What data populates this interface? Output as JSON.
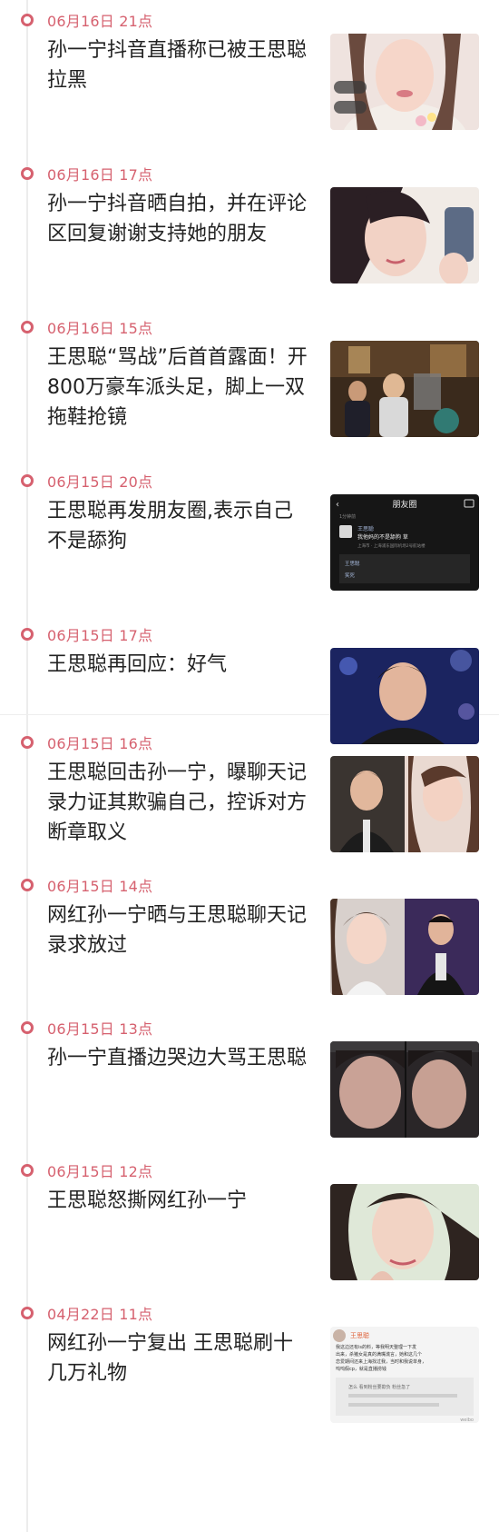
{
  "feed": {
    "items": [
      {
        "time": "06月16日 21点",
        "title": "孙一宁抖音直播称已被王思聪拉黑",
        "thumbnail": "livestream-screenshot"
      },
      {
        "time": "06月16日 17点",
        "title": "孙一宁抖音晒自拍，并在评论区回复谢谢支持她的朋友",
        "thumbnail": "selfie-photo"
      },
      {
        "time": "06月16日 15点",
        "title": "王思聪“骂战”后首首露面！开800万豪车派头足，脚上一双拖鞋抢镜",
        "thumbnail": "night-street-photo"
      },
      {
        "time": "06月15日 20点",
        "title": "王思聪再发朋友圈,表示自己不是舔狗",
        "thumbnail": "moments-screenshot",
        "moments": {
          "header": "朋友圈",
          "timestamp": "1分钟前",
          "name": "王思聪",
          "text": "我他妈的不是舔狗 草",
          "location": "上海市 · 上海浦东国际机场2号航站楼",
          "like": "王思聪",
          "reply": "笑死"
        }
      },
      {
        "time": "06月15日 17点",
        "title": "王思聪再回应：好气",
        "thumbnail": "portrait-photo"
      },
      {
        "time": "06月15日 16点",
        "title": "王思聪回击孙一宁，曝聊天记录力证其欺骗自己，控诉对方断章取义",
        "thumbnail": "split-portraits"
      },
      {
        "time": "06月15日 14点",
        "title": "网红孙一宁晒与王思聪聊天记录求放过",
        "thumbnail": "split-portraits-2"
      },
      {
        "time": "06月15日 13点",
        "title": "孙一宁直播边哭边大骂王思聪",
        "thumbnail": "livestream-crying"
      },
      {
        "time": "06月15日 12点",
        "title": "王思聪怒撕网红孙一宁",
        "thumbnail": "portrait-photo-2"
      },
      {
        "time": "04月22日 11点",
        "title": "网红孙一宁复出 王思聪刷十几万礼物",
        "thumbnail": "comment-screenshot",
        "comment": {
          "name": "王思聪",
          "lines": [
            "我这边还有is的料，等我明天整理一下发",
            "出来，杀猪女是真的满嘴谎言，她和这几个",
            "恋爱期间还来上海找过我，当时和我说单身，",
            "呜呜假cp，就是直播捞钱"
          ],
          "reply": "怎么 看到粉丝要欺负 粉丝急了",
          "footer": "weibo"
        }
      }
    ]
  },
  "colors": {
    "accent": "#d6616f",
    "text": "#222222",
    "timeline": "#ececec"
  }
}
